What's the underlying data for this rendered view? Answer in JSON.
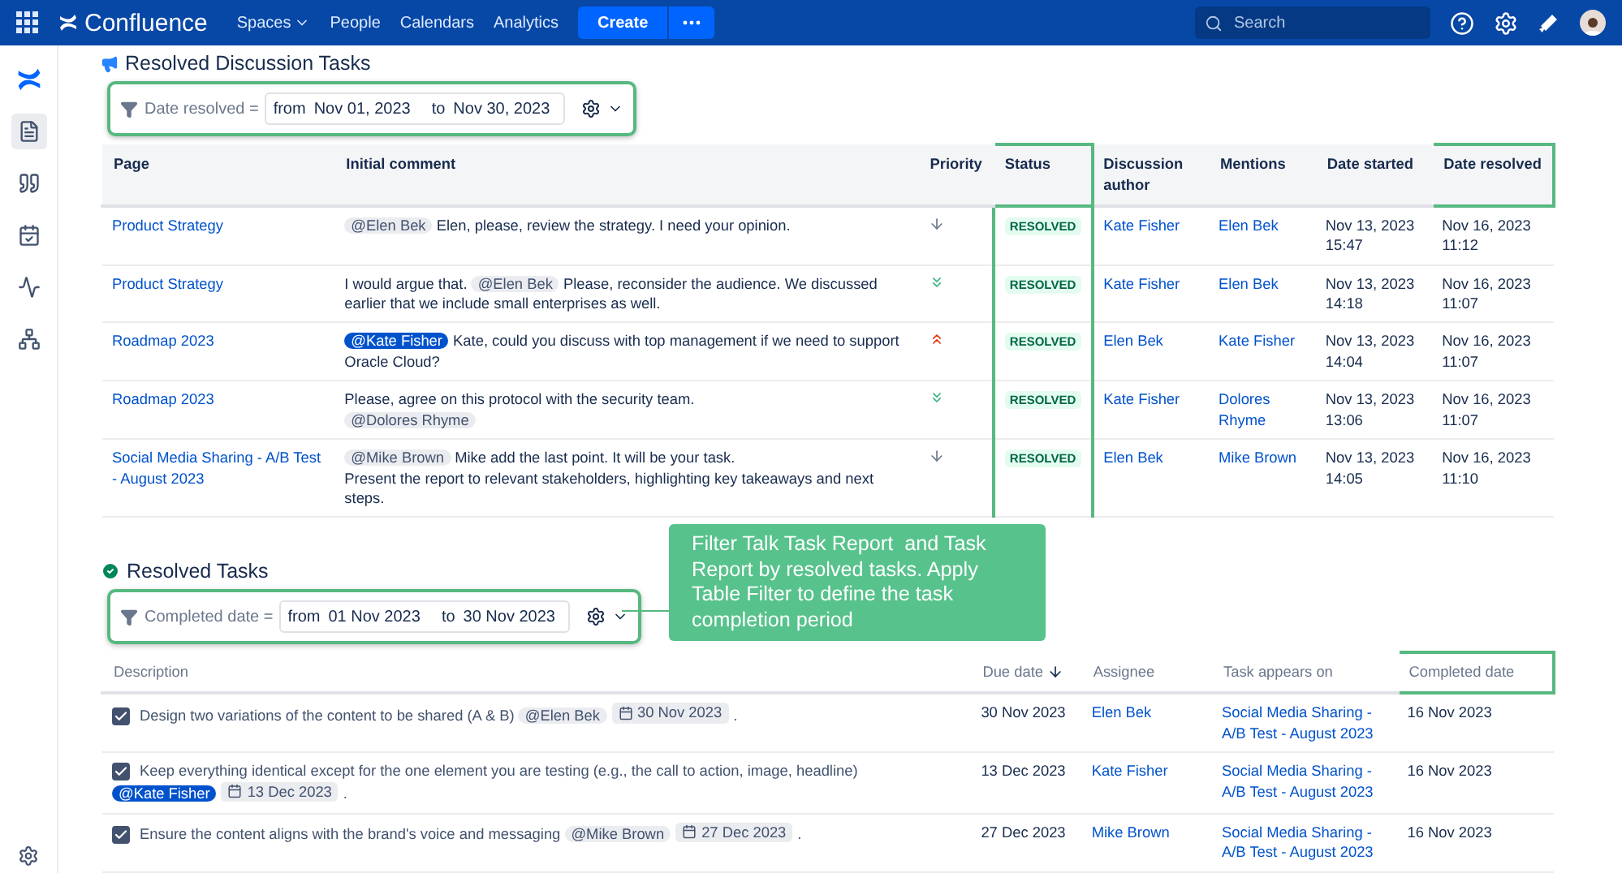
{
  "topbar": {
    "logo": "Confluence",
    "nav": [
      {
        "label": "Spaces",
        "dropdown": true
      },
      {
        "label": "People",
        "dropdown": false
      },
      {
        "label": "Calendars",
        "dropdown": false
      },
      {
        "label": "Analytics",
        "dropdown": false
      }
    ],
    "create": "Create",
    "search": {
      "placeholder": "Search"
    }
  },
  "discussions": {
    "title": "Resolved Discussion Tasks",
    "filter": {
      "label": "Date resolved =",
      "from_word": "from",
      "from": "Nov 01, 2023",
      "to_word": "to",
      "to": "Nov 30, 2023",
      "highlighted": true
    },
    "columns": [
      {
        "label": "Page",
        "highlighted": false
      },
      {
        "label": "Initial comment",
        "highlighted": false
      },
      {
        "label": "Priority",
        "highlighted": false
      },
      {
        "label": "Status",
        "highlighted": true
      },
      {
        "label": "Discussion author",
        "highlighted": false
      },
      {
        "label": "Mentions",
        "highlighted": false
      },
      {
        "label": "Date started",
        "highlighted": false
      },
      {
        "label": "Date resolved",
        "highlighted": true
      }
    ],
    "rows": [
      {
        "page": "Product Strategy",
        "comment": [
          {
            "kind": "mention",
            "text": "@Elen Bek",
            "own": false
          },
          {
            "kind": "text",
            "text": "Elen, please, review the strategy. I need your opinion."
          }
        ],
        "priority": {
          "kind": "low"
        },
        "status": "RESOLVED",
        "author": "Kate Fisher",
        "mentions": "Elen Bek",
        "started": [
          "Nov 13, 2023",
          "15:47"
        ],
        "resolved": [
          "Nov 16, 2023",
          "11:12"
        ]
      },
      {
        "page": "Product Strategy",
        "comment": [
          {
            "kind": "text",
            "text": "I would argue that."
          },
          {
            "kind": "mention",
            "text": "@Elen Bek",
            "own": false
          },
          {
            "kind": "text",
            "text": "Please, reconsider the audience. We discussed earlier that we include small enterprises as well."
          }
        ],
        "priority": {
          "kind": "lowest"
        },
        "status": "RESOLVED",
        "author": "Kate Fisher",
        "mentions": "Elen Bek",
        "started": [
          "Nov 13, 2023",
          "14:18"
        ],
        "resolved": [
          "Nov 16, 2023",
          "11:07"
        ]
      },
      {
        "page": "Roadmap 2023",
        "comment": [
          {
            "kind": "mention",
            "text": "@Kate Fisher",
            "own": true
          },
          {
            "kind": "text",
            "text": "Kate, could you discuss with top management if we need to support Oracle Cloud?"
          }
        ],
        "priority": {
          "kind": "highest"
        },
        "status": "RESOLVED",
        "author": "Elen Bek",
        "mentions": "Kate Fisher",
        "started": [
          "Nov 13, 2023",
          "14:04"
        ],
        "resolved": [
          "Nov 16, 2023",
          "11:07"
        ]
      },
      {
        "page": "Roadmap 2023",
        "comment": [
          {
            "kind": "text",
            "text": "Please, agree on this protocol with the security team."
          },
          {
            "kind": "break"
          },
          {
            "kind": "mention",
            "text": "@Dolores Rhyme",
            "own": false
          }
        ],
        "priority": {
          "kind": "lowest"
        },
        "status": "RESOLVED",
        "author": "Kate Fisher",
        "mentions": "Dolores Rhyme",
        "started": [
          "Nov 13, 2023",
          "13:06"
        ],
        "resolved": [
          "Nov 16, 2023",
          "11:07"
        ]
      },
      {
        "page": "Social Media Sharing - A/B Test - August 2023",
        "comment": [
          {
            "kind": "mention",
            "text": "@Mike Brown",
            "own": false
          },
          {
            "kind": "text",
            "text": "Mike add the last point. It will be your task."
          },
          {
            "kind": "break"
          },
          {
            "kind": "text",
            "text": "Present the report to relevant stakeholders, highlighting key takeaways and next steps."
          }
        ],
        "priority": {
          "kind": "low"
        },
        "status": "RESOLVED",
        "author": "Elen Bek",
        "mentions": "Mike Brown",
        "started": [
          "Nov 13, 2023",
          "14:05"
        ],
        "resolved": [
          "Nov 16, 2023",
          "11:10"
        ]
      }
    ]
  },
  "tasks": {
    "title": "Resolved Tasks",
    "filter": {
      "label": "Completed date =",
      "from_word": "from",
      "from": "01 Nov 2023",
      "to_word": "to",
      "to": "30 Nov 2023",
      "highlighted": true
    },
    "columns": [
      {
        "label": "Description",
        "highlighted": false,
        "sorted": false
      },
      {
        "label": "Due date",
        "highlighted": false,
        "sorted": true
      },
      {
        "label": "Assignee",
        "highlighted": false,
        "sorted": false
      },
      {
        "label": "Task appears on",
        "highlighted": false,
        "sorted": false
      },
      {
        "label": "Completed date",
        "highlighted": true,
        "sorted": false
      }
    ],
    "rows": [
      {
        "checked": true,
        "description": [
          {
            "kind": "text",
            "text": "Design two variations of the content to be shared (A & B)"
          },
          {
            "kind": "mention",
            "text": "@Elen Bek",
            "own": false
          },
          {
            "kind": "date",
            "text": "30 Nov 2023"
          },
          {
            "kind": "text",
            "text": "."
          }
        ],
        "due": "30 Nov 2023",
        "assignee": "Elen Bek",
        "page": "Social Media Sharing - A/B Test - August 2023",
        "completed": "16 Nov 2023"
      },
      {
        "checked": true,
        "description": [
          {
            "kind": "text",
            "text": "Keep everything identical except for the one element you are testing (e.g., the call to action, image, headline)"
          },
          {
            "kind": "mention",
            "text": "@Kate Fisher",
            "own": true
          },
          {
            "kind": "date",
            "text": "13 Dec 2023"
          },
          {
            "kind": "text",
            "text": "."
          }
        ],
        "due": "13 Dec 2023",
        "assignee": "Kate Fisher",
        "page": "Social Media Sharing - A/B Test - August 2023",
        "completed": "16 Nov 2023"
      },
      {
        "checked": true,
        "description": [
          {
            "kind": "text",
            "text": "Ensure the content aligns with the brand's voice and messaging"
          },
          {
            "kind": "mention",
            "text": "@Mike Brown",
            "own": false
          },
          {
            "kind": "date",
            "text": "27 Dec 2023"
          },
          {
            "kind": "text",
            "text": "."
          }
        ],
        "due": "27 Dec 2023",
        "assignee": "Mike Brown",
        "page": "Social Media Sharing - A/B Test - August 2023",
        "completed": "16 Nov 2023"
      }
    ]
  },
  "callout": "Filter Talk Task Report  and Task Report by resolved tasks. Apply Table Filter to define the task completion period"
}
